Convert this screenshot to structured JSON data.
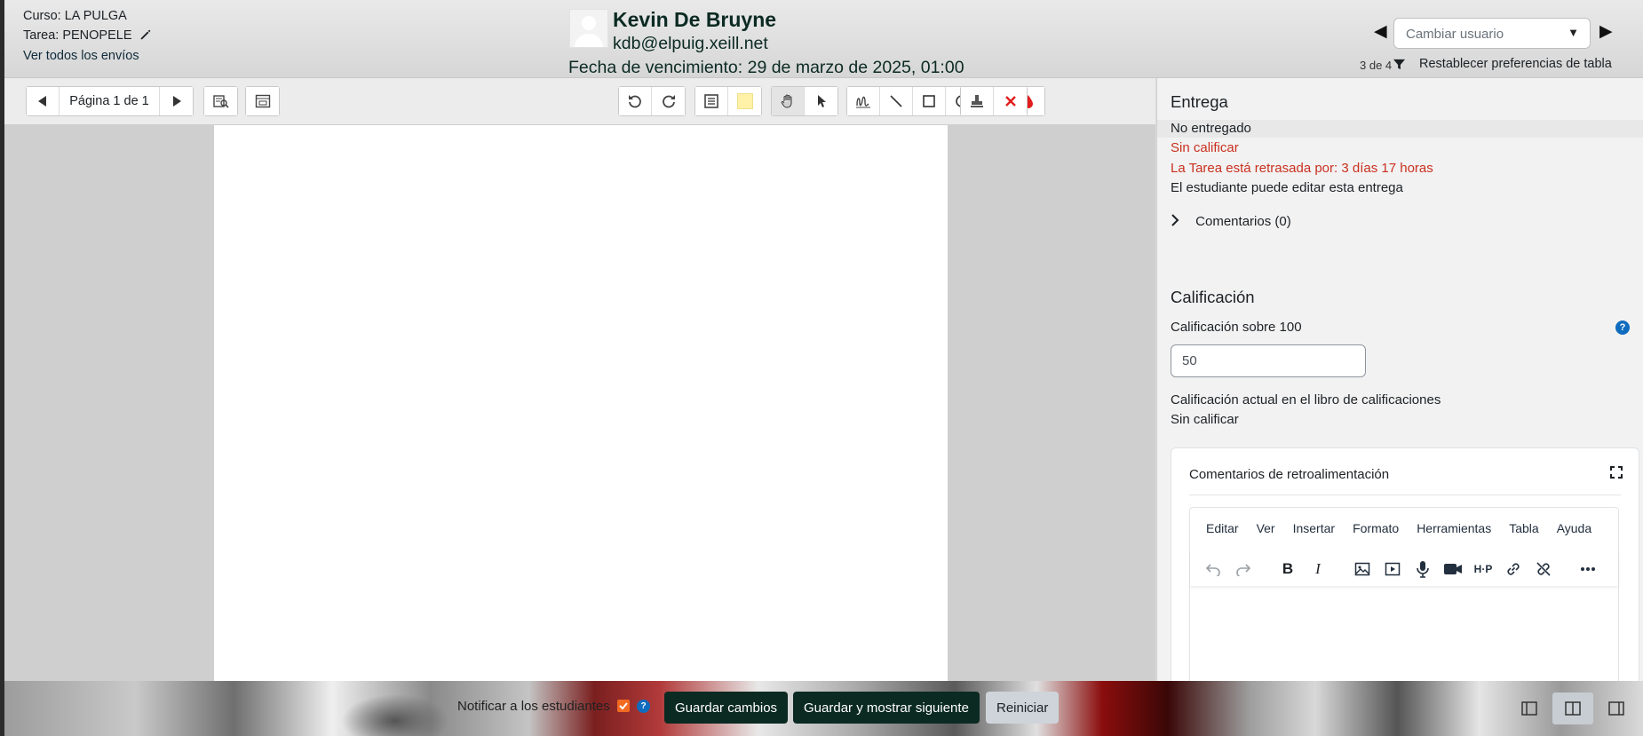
{
  "header": {
    "course": "Curso: LA PULGA",
    "assignment": "Tarea: PENOPELE",
    "view_all": "Ver todos los envíos",
    "user_name": "Kevin De Bruyne",
    "user_email": "kdb@elpuig.xeill.net",
    "due_date": "Fecha de vencimiento: 29 de marzo de 2025, 01:00",
    "change_user_placeholder": "Cambiar usuario",
    "user_count": "3 de 4",
    "reset_prefs": "Restablecer preferencias de tabla"
  },
  "toolbar": {
    "page_label": "Página 1 de 1"
  },
  "submission": {
    "heading": "Entrega",
    "status": "No entregado",
    "grading_status": "Sin calificar",
    "overdue": "La Tarea está retrasada por: 3 días 17 horas",
    "editable": "El estudiante puede editar esta entrega",
    "comments": "Comentarios (0)"
  },
  "grade": {
    "heading": "Calificación",
    "label": "Calificación sobre 100",
    "value": "50",
    "current_label": "Calificación actual en el libro de calificaciones",
    "current_value": "Sin calificar"
  },
  "feedback": {
    "title": "Comentarios de retroalimentación",
    "menu": [
      "Editar",
      "Ver",
      "Insertar",
      "Formato",
      "Herramientas",
      "Tabla",
      "Ayuda"
    ]
  },
  "footer": {
    "notify_label": "Notificar a los estudiantes",
    "save": "Guardar cambios",
    "save_next": "Guardar y mostrar siguiente",
    "reset": "Reiniciar"
  },
  "colors": {
    "accent_dark": "#0b2a22",
    "warning_red": "#ca3120",
    "help_blue": "#0f6cbf",
    "checkbox_orange": "#f26b21"
  }
}
